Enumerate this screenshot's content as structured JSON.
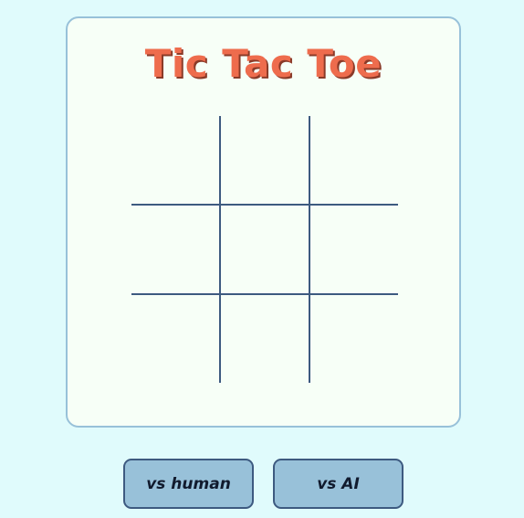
{
  "game": {
    "title": "Tic Tac Toe",
    "board": {
      "cells": [
        "",
        "",
        "",
        "",
        "",
        "",
        "",
        "",
        ""
      ]
    },
    "modes": {
      "human_label": "vs human",
      "ai_label": "vs AI"
    }
  },
  "colors": {
    "background": "#e0fbfc",
    "panel": "#f7fff7",
    "panel_border": "#98c1d9",
    "title": "#ee6c4d",
    "grid": "#3d5a80",
    "button": "#98c1d9"
  }
}
